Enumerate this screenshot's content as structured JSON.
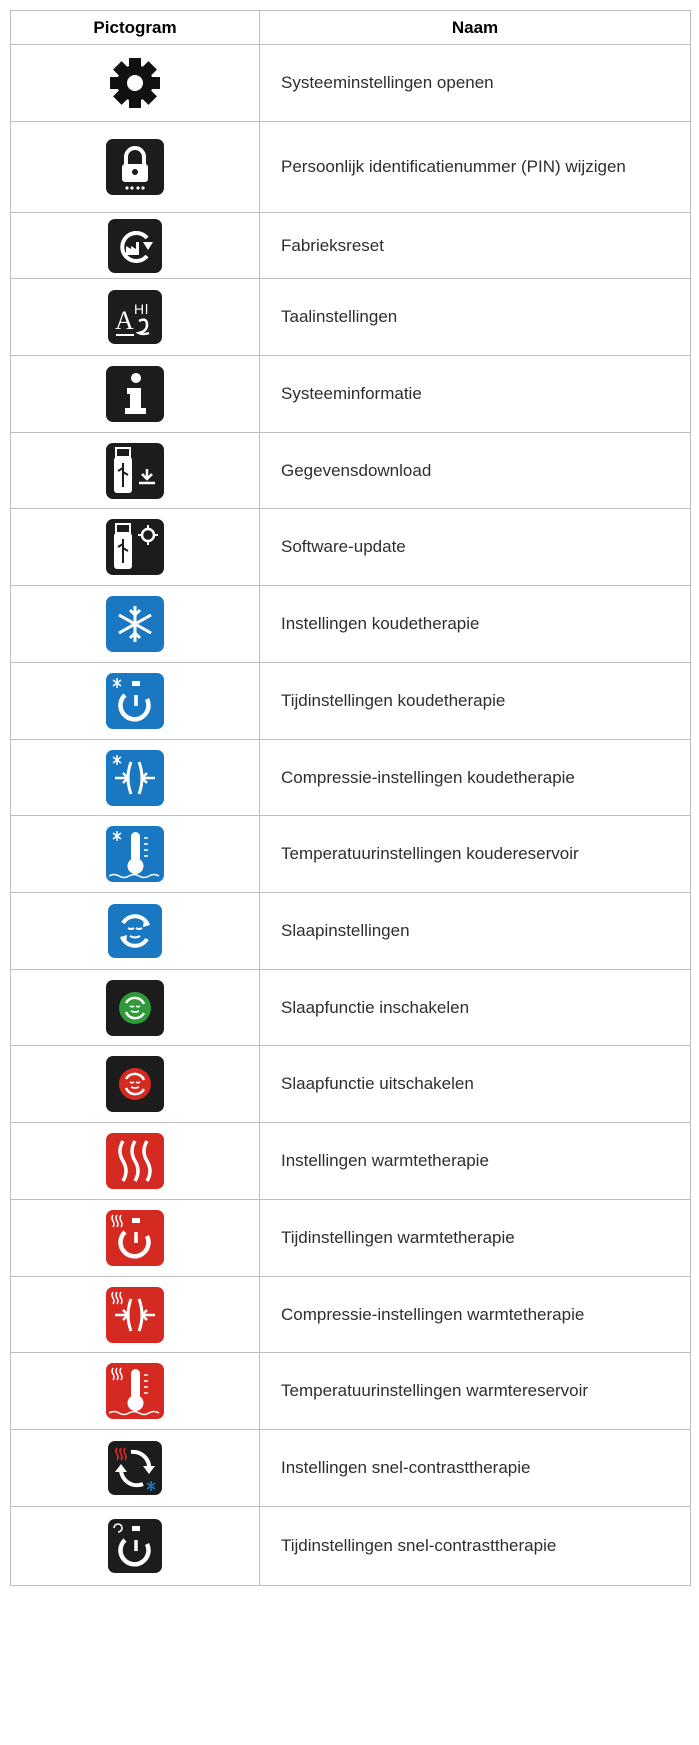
{
  "table": {
    "headers": [
      "Pictogram",
      "Naam"
    ],
    "rows": [
      {
        "icon": "gear-icon",
        "label": "Systeeminstellingen openen"
      },
      {
        "icon": "lock-pin-icon",
        "label": "Persoonlijk identificatienummer (PIN) wijzigen"
      },
      {
        "icon": "factory-reset-icon",
        "label": "Fabrieksreset"
      },
      {
        "icon": "language-icon",
        "label": "Taalinstellingen"
      },
      {
        "icon": "info-icon",
        "label": "Systeeminformatie"
      },
      {
        "icon": "usb-download-icon",
        "label": "Gegevensdownload"
      },
      {
        "icon": "usb-software-update-icon",
        "label": "Software-update"
      },
      {
        "icon": "snowflake-icon",
        "label": "Instellingen koudetherapie"
      },
      {
        "icon": "cold-timer-icon",
        "label": "Tijdinstellingen koudetherapie"
      },
      {
        "icon": "cold-compression-icon",
        "label": "Compressie-instellingen koudetherapie"
      },
      {
        "icon": "cold-reservoir-thermometer-icon",
        "label": "Temperatuurinstellingen koudereservoir"
      },
      {
        "icon": "sleep-settings-icon",
        "label": "Slaapinstellingen"
      },
      {
        "icon": "sleep-on-icon",
        "label": "Slaapfunctie inschakelen"
      },
      {
        "icon": "sleep-off-icon",
        "label": "Slaapfunctie uitschakelen"
      },
      {
        "icon": "heat-waves-icon",
        "label": "Instellingen warmtetherapie"
      },
      {
        "icon": "heat-timer-icon",
        "label": "Tijdinstellingen warmtetherapie"
      },
      {
        "icon": "heat-compression-icon",
        "label": "Compressie-instellingen warmtetherapie"
      },
      {
        "icon": "heat-reservoir-thermometer-icon",
        "label": "Temperatuurinstellingen warmtereservoir"
      },
      {
        "icon": "contrast-cycle-icon",
        "label": "Instellingen snel-contrasttherapie"
      },
      {
        "icon": "contrast-timer-icon",
        "label": "Tijdinstellingen snel-contrasttherapie"
      }
    ]
  },
  "colors": {
    "black_tile": "#1c1c1c",
    "blue_tile": "#1a78c2",
    "red_tile": "#d42a22",
    "green_tile": "#2e9a3a",
    "border": "#bdbdbd",
    "text": "#2e2e2e"
  }
}
